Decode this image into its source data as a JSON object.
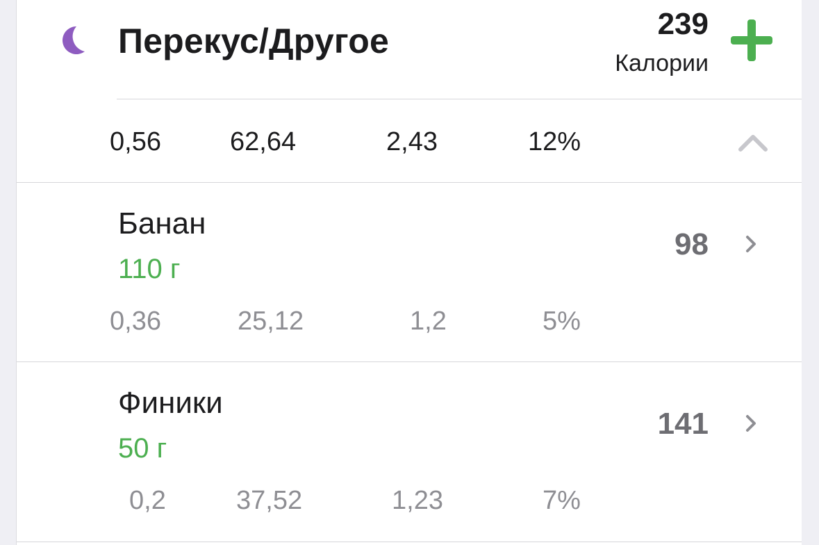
{
  "meal": {
    "icon": "moon-icon",
    "title": "Перекус/Другое",
    "calories_value": "239",
    "calories_label": "Калории",
    "add_icon": "plus-icon"
  },
  "summary": {
    "fat": "0,56",
    "carbs": "62,64",
    "protein": "2,43",
    "percent": "12%",
    "collapse_icon": "chevron-up-icon"
  },
  "items": [
    {
      "name": "Банан",
      "amount": "110 г",
      "calories": "98",
      "fat": "0,36",
      "carbs": "25,12",
      "protein": "1,2",
      "percent": "5%"
    },
    {
      "name": "Финики",
      "amount": "50 г",
      "calories": "141",
      "fat": "0,2",
      "carbs": "37,52",
      "protein": "1,23",
      "percent": "7%"
    }
  ],
  "colors": {
    "accent_green": "#4caf50",
    "moon_purple": "#8e5cc0",
    "text_dark": "#1c1c1e",
    "text_gray": "#8e8e93"
  }
}
